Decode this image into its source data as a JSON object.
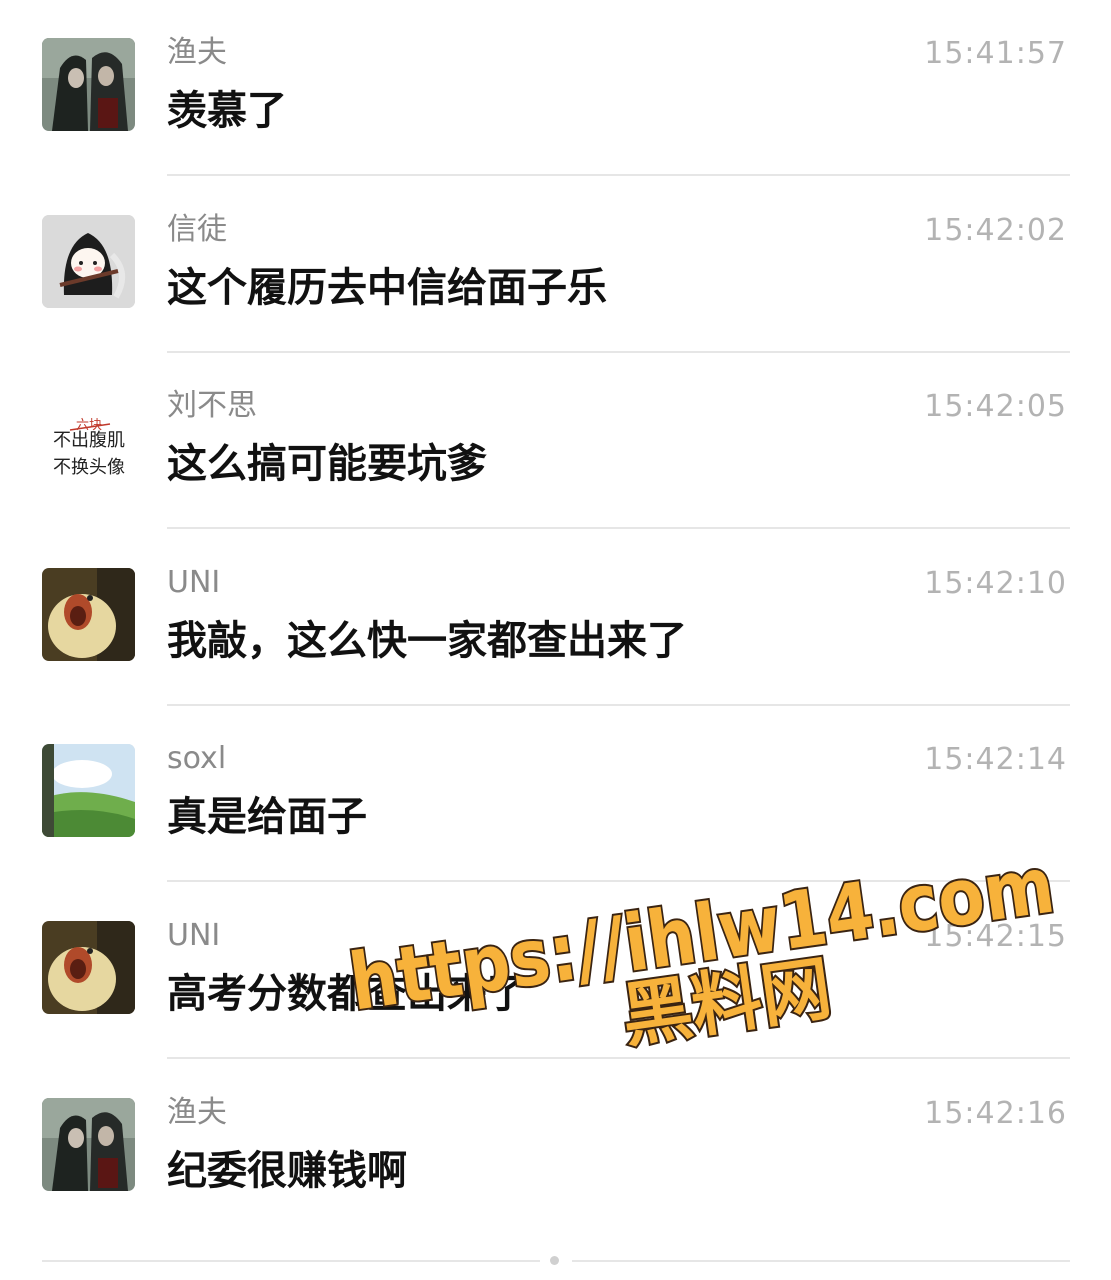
{
  "messages": [
    {
      "sender": "渔夫",
      "time": "15:41:57",
      "text": "羡慕了",
      "avatar": "anime-duo-icon"
    },
    {
      "sender": "信徒",
      "time": "15:42:02",
      "text": "这个履历去中信给面子乐",
      "avatar": "reaper-chibi-icon"
    },
    {
      "sender": "刘不思",
      "time": "15:42:05",
      "text": "这么搞可能要坑爹",
      "avatar": "text-avatar-icon",
      "avatar_text": [
        "六块",
        "不出腹肌",
        "不换头像"
      ]
    },
    {
      "sender": "UNI",
      "time": "15:42:10",
      "text": "我敲，这么快一家都查出来了",
      "avatar": "dog-photo-icon"
    },
    {
      "sender": "soxl",
      "time": "15:42:14",
      "text": "真是给面子",
      "avatar": "mountain-photo-icon"
    },
    {
      "sender": "UNI",
      "time": "15:42:15",
      "text": "高考分数都查出来了",
      "avatar": "dog-photo-icon"
    },
    {
      "sender": "渔夫",
      "time": "15:42:16",
      "text": "纪委很赚钱啊",
      "avatar": "anime-duo-icon"
    }
  ],
  "watermark": {
    "line1": "https://ihlw14.com",
    "line2": "黑料网",
    "color": "#f7b23b"
  }
}
